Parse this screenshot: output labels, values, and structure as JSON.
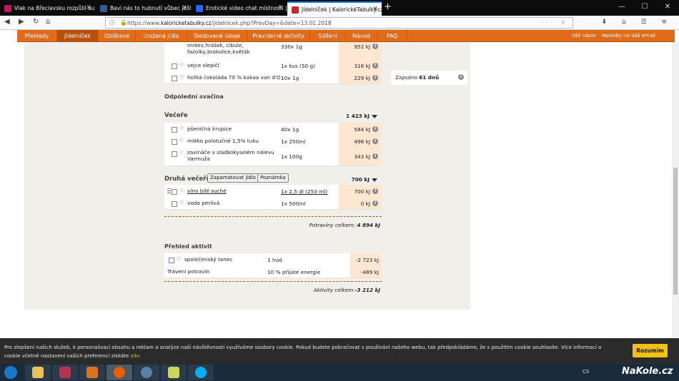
{
  "browser": {
    "tabs": [
      {
        "title": "Vlak na Břeclavsku rozpůlil auto",
        "color": "#c2185b"
      },
      {
        "title": "Baví nás to hubnutí vůbec ještě",
        "color": "#3b5998"
      },
      {
        "title": "Erotické video chat místnosti |",
        "color": "#2962ff"
      },
      {
        "title": "Jídelníček | KalorickéTabulky.cz",
        "color": "#c62828"
      }
    ],
    "url_prefix": "https://www.",
    "url_domain": "kaloricketabulky.cz",
    "url_path": "/jidelnicek.php?PrevDay=&date=13.01.2018"
  },
  "sitenav": {
    "items": [
      "Přehledy",
      "Jídelníček",
      "Oblíbené",
      "Uložená jídla",
      "Sledované údaje",
      "Pravidelné aktivity",
      "Sdílení",
      "Návod",
      "FAQ"
    ],
    "right": [
      "Váš názor",
      "Novinky na Váš email"
    ]
  },
  "meals_top": [
    {
      "name": "mrkev,hrášek, cibule, fazolky,brokolice,květák",
      "amount": "330x 1g",
      "kj": "952 kJ"
    },
    {
      "name": "vejce slepičí",
      "amount": "1x kus (50 g)",
      "kj": "316 kJ"
    },
    {
      "name": "hořká čokoláda 70 % kakaa van d'Or",
      "amount": "10x 1g",
      "kj": "229 kJ"
    }
  ],
  "svacina": {
    "title": "Odpolední svačina"
  },
  "vecere": {
    "title": "Večeře",
    "total": "1 423 kJ",
    "items": [
      {
        "name": "pšeničná krupice",
        "amount": "40x 1g",
        "kj": "584 kJ"
      },
      {
        "name": "mléko polotučné 1,5% tuku",
        "amount": "1x 250ml",
        "kj": "496 kJ"
      },
      {
        "name": "zavináče v sladkokyselém nálevu Varmuža",
        "amount": "1x 100g",
        "kj": "343 kJ"
      }
    ]
  },
  "druha_vecere": {
    "title": "Druhá večeře",
    "total": "700 kJ",
    "btn_save": "Zapamatovat jídlo",
    "btn_note": "Poznámka",
    "items": [
      {
        "name": "víno bílé suché",
        "amount": "1x 2,5 dl (250 ml)",
        "kj": "700 kJ"
      },
      {
        "name": "voda perlivá",
        "amount": "1x 500ml",
        "kj": "0 kJ"
      }
    ]
  },
  "food_total": {
    "label": "Potraviny celkem:",
    "value": "4 894 kJ"
  },
  "activities": {
    "title": "Přehled aktivit",
    "items": [
      {
        "name": "společenský tanec",
        "amount": "1 hod",
        "kj": "-2 723 kJ"
      },
      {
        "name": "Trávení potravin",
        "amount": "10 % přijaté energie",
        "kj": "-489 kJ"
      }
    ],
    "total_label": "Aktivity celkem",
    "total_value": "-3 212 kJ"
  },
  "side": {
    "label": "Zapsáno",
    "value": "61 dnů"
  },
  "cookie": {
    "text": "Pro zlepšení našich služeb, k personalizaci obsahu a reklam a analýze naší návštěvnosti využíváme soubory cookie. Pokud budete pokračovat v používání našeho webu, tak předpokládáme, že s použitím cookie souhlasíte. Více informací o cookie včetně nastavení vašich preferencí získáte",
    "link": "zde",
    "button": "Rozumím"
  },
  "taskbar": {
    "lang": "CS",
    "brand": "NaKole.cz"
  }
}
